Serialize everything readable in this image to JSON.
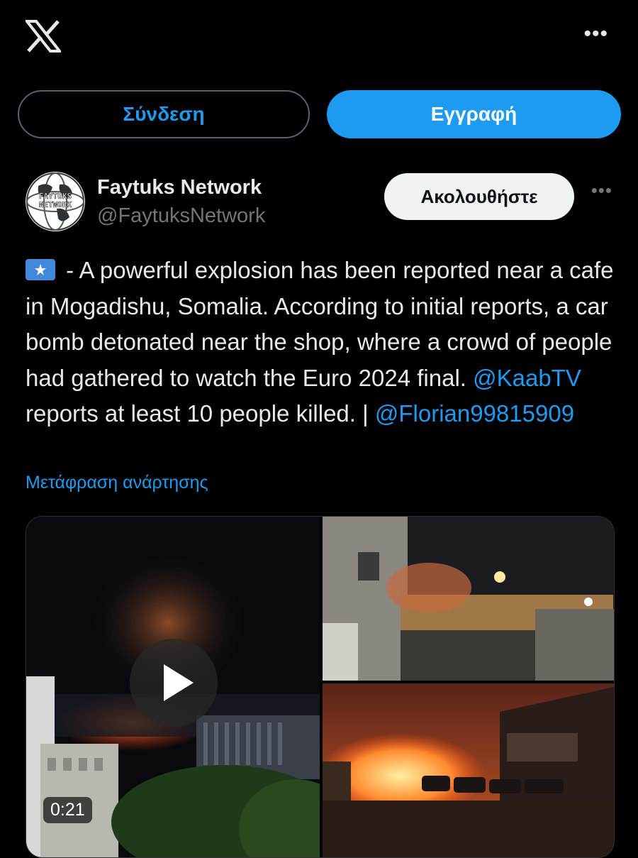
{
  "header": {
    "logo_icon": "x-logo-icon",
    "more_icon": "more-horizontal-icon"
  },
  "auth": {
    "login_label": "Σύνδεση",
    "signup_label": "Εγγραφή"
  },
  "post": {
    "author_name": "Faytuks Network",
    "author_handle": "@FaytuksNetwork",
    "avatar_text": [
      "FAYTUKS",
      "NETWORK"
    ],
    "follow_label": "Ακολουθήστε",
    "text_flag": "somalia-flag-emoji",
    "text_part1": " - A powerful explosion has been reported near a cafe in Mogadishu, Somalia. According to initial reports, a car bomb detonated near the shop, where a crowd of people had gathered to watch the Euro 2024 final. ",
    "mention1": "@KaabTV",
    "text_part2": " reports at least 10 people killed. | ",
    "mention2": "@Florian99815909",
    "translate_label": "Μετάφραση ανάρτησης"
  },
  "media": {
    "video_duration": "0:21",
    "play_icon": "play-icon"
  },
  "colors": {
    "background": "#000000",
    "accent": "#1d9bf0",
    "text": "#e7e9ea",
    "secondary_text": "#71767b"
  }
}
